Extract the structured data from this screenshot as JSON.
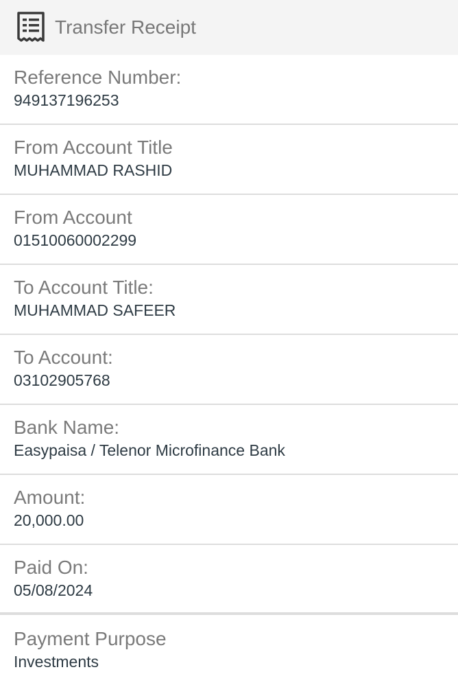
{
  "header": {
    "title": "Transfer Receipt",
    "icon": "receipt-icon"
  },
  "fields": [
    {
      "label": "Reference Number:",
      "value": "949137196253"
    },
    {
      "label": "From Account Title",
      "value": "MUHAMMAD RASHID"
    },
    {
      "label": "From Account",
      "value": "01510060002299"
    },
    {
      "label": "To Account Title:",
      "value": "MUHAMMAD SAFEER"
    },
    {
      "label": "To Account:",
      "value": "03102905768"
    },
    {
      "label": "Bank Name:",
      "value": "Easypaisa / Telenor Microfinance Bank"
    },
    {
      "label": "Amount:",
      "value": "20,000.00"
    },
    {
      "label": "Paid On:",
      "value": "05/08/2024"
    },
    {
      "label": "Payment Purpose",
      "value": "Investments"
    }
  ]
}
